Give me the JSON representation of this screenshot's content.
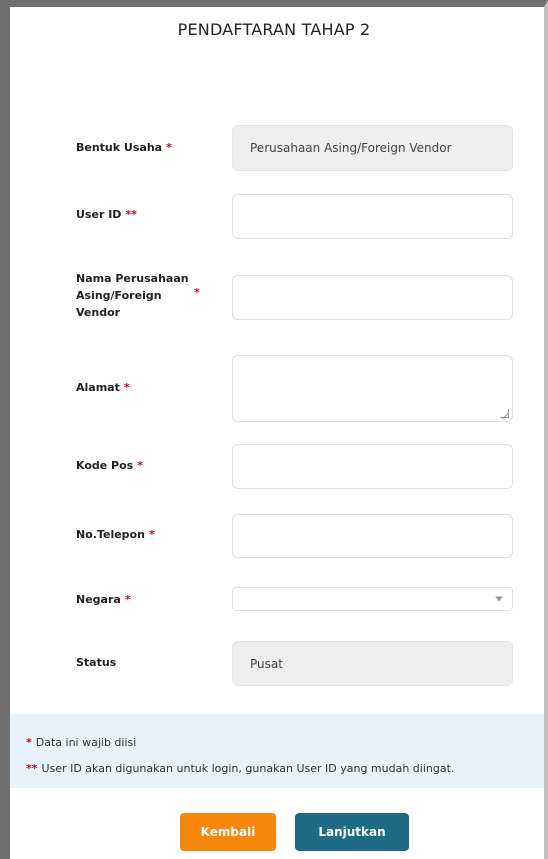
{
  "title": "PENDAFTARAN TAHAP 2",
  "form": {
    "bentuk_usaha": {
      "label": "Bentuk Usaha",
      "req": "*",
      "value": "Perusahaan Asing/Foreign Vendor"
    },
    "user_id": {
      "label": "User ID",
      "req": "**",
      "value": ""
    },
    "nama_perusahaan": {
      "label_line1": "Nama Perusahaan",
      "label_line2": "Asing/Foreign",
      "label_line3": "Vendor",
      "req": "*",
      "value": ""
    },
    "alamat": {
      "label": "Alamat",
      "req": "*",
      "value": ""
    },
    "kode_pos": {
      "label": "Kode Pos",
      "req": "*",
      "value": ""
    },
    "telepon": {
      "label": "No.Telepon",
      "req": "*",
      "value": ""
    },
    "negara": {
      "label": "Negara",
      "req": "*",
      "value": ""
    },
    "status": {
      "label": "Status",
      "value": "Pusat"
    }
  },
  "notes": {
    "required_mark": "*",
    "required_text": "Data ini wajib diisi",
    "userid_mark": "**",
    "userid_text": "User ID akan digunakan untuk login, gunakan User ID yang mudah diingat."
  },
  "buttons": {
    "back": "Kembali",
    "next": "Lanjutkan"
  },
  "colors": {
    "required": "#d0021b",
    "back_button": "#f7860d",
    "next_button": "#1e6b86",
    "note_bg": "#e8f2fb"
  },
  "icons": {
    "select_caret": "chevron-down-icon",
    "textarea_resize": "resize-handle-icon"
  }
}
